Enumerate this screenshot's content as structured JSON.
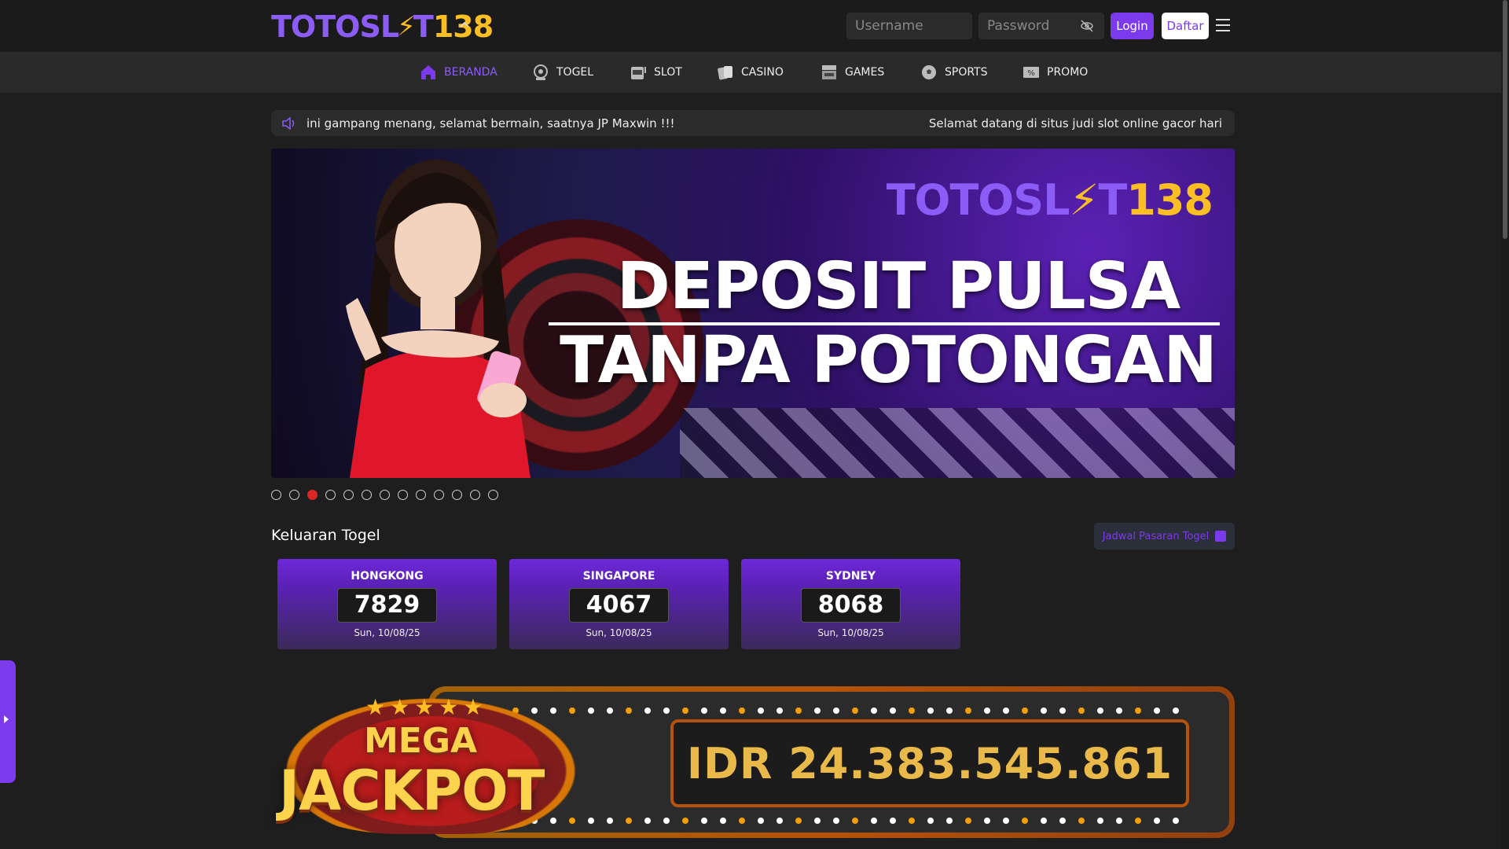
{
  "header": {
    "logo_text_1": "TOTOSL",
    "logo_bolt": "⚡",
    "logo_text_2": "T",
    "logo_text_3": "138",
    "username_placeholder": "Username",
    "password_placeholder": "Password",
    "login_label": "Login",
    "daftar_label": "Daftar"
  },
  "nav": [
    {
      "label": "BERANDA",
      "icon": "home-icon",
      "active": true
    },
    {
      "label": "TOGEL",
      "icon": "togel-icon"
    },
    {
      "label": "SLOT",
      "icon": "slot-machine-icon"
    },
    {
      "label": "CASINO",
      "icon": "cards-icon"
    },
    {
      "label": "GAMES",
      "icon": "arcade-icon"
    },
    {
      "label": "SPORTS",
      "icon": "soccer-ball-icon"
    },
    {
      "label": "PROMO",
      "icon": "discount-icon"
    }
  ],
  "marquee": {
    "left_text": "ini gampang menang, selamat bermain, saatnya JP Maxwin !!!",
    "right_text": "Selamat datang di situs judi slot online gacor hari"
  },
  "banner": {
    "logo_a": "TOTOSL",
    "logo_bolt": "⚡",
    "logo_a2": "T",
    "logo_b": "138",
    "line1": "DEPOSIT PULSA",
    "line2": "TANPA POTONGAN",
    "slide_count": 13,
    "active_slide": 3
  },
  "togel": {
    "section_title": "Keluaran Togel",
    "schedule_button": "Jadwal Pasaran Togel",
    "results": [
      {
        "market": "HONGKONG",
        "number": "7829",
        "date": "Sun, 10/08/25"
      },
      {
        "market": "SINGAPORE",
        "number": "4067",
        "date": "Sun, 10/08/25"
      },
      {
        "market": "SYDNEY",
        "number": "8068",
        "date": "Sun, 10/08/25"
      }
    ]
  },
  "jackpot": {
    "mega_label": "MEGA",
    "jackpot_label": "JACKPOT",
    "amount": "IDR 24.383.545.861"
  },
  "colors": {
    "accent": "#7c3aed",
    "gold": "#fbbf24",
    "background": "#1e1e1e",
    "active_dot": "#dc2626"
  }
}
